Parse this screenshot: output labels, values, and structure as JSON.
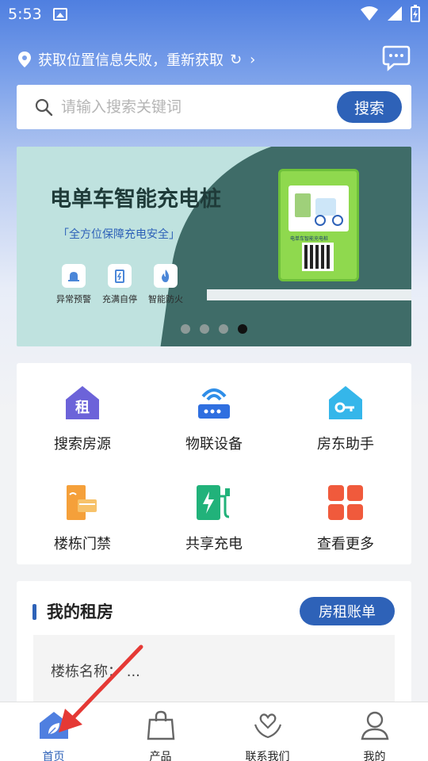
{
  "status_bar": {
    "time": "5:53"
  },
  "location": {
    "text": "获取位置信息失败，重新获取",
    "refresh_icon": "refresh-icon",
    "chevron_icon": "chevron-right-icon"
  },
  "message_icon": "chat-bubble-icon",
  "search": {
    "placeholder": "请输入搜索关键词",
    "button_label": "搜索"
  },
  "banner": {
    "title": "电单车智能充电桩",
    "subtitle": "「全方位保障充电安全」",
    "features": [
      {
        "label": "异常预警",
        "icon": "alarm-icon"
      },
      {
        "label": "充满自停",
        "icon": "battery-full-icon"
      },
      {
        "label": "智能防火",
        "icon": "fire-icon"
      }
    ],
    "device_label": "电单车智能充电桩",
    "slide_count": 4,
    "active_slide": 4
  },
  "grid": [
    {
      "label": "搜索房源",
      "icon": "rent-house-icon",
      "icon_char": "租"
    },
    {
      "label": "物联设备",
      "icon": "router-icon"
    },
    {
      "label": "房东助手",
      "icon": "house-key-icon"
    },
    {
      "label": "楼栋门禁",
      "icon": "door-access-icon"
    },
    {
      "label": "共享充电",
      "icon": "charging-station-icon"
    },
    {
      "label": "查看更多",
      "icon": "more-grid-icon"
    }
  ],
  "my_rent": {
    "title": "我的租房",
    "bill_button": "房租账单",
    "building_label": "楼栋名称：",
    "building_value": "..."
  },
  "tabbar": [
    {
      "label": "首页",
      "icon": "home-leaf-icon",
      "active": true
    },
    {
      "label": "产品",
      "icon": "bag-icon",
      "active": false
    },
    {
      "label": "联系我们",
      "icon": "heart-hands-icon",
      "active": false
    },
    {
      "label": "我的",
      "icon": "user-icon",
      "active": false
    }
  ],
  "colors": {
    "primary": "#2e62b8",
    "header_gradient_top": "#4f7fe0",
    "banner_bg": "#bfe2df"
  }
}
